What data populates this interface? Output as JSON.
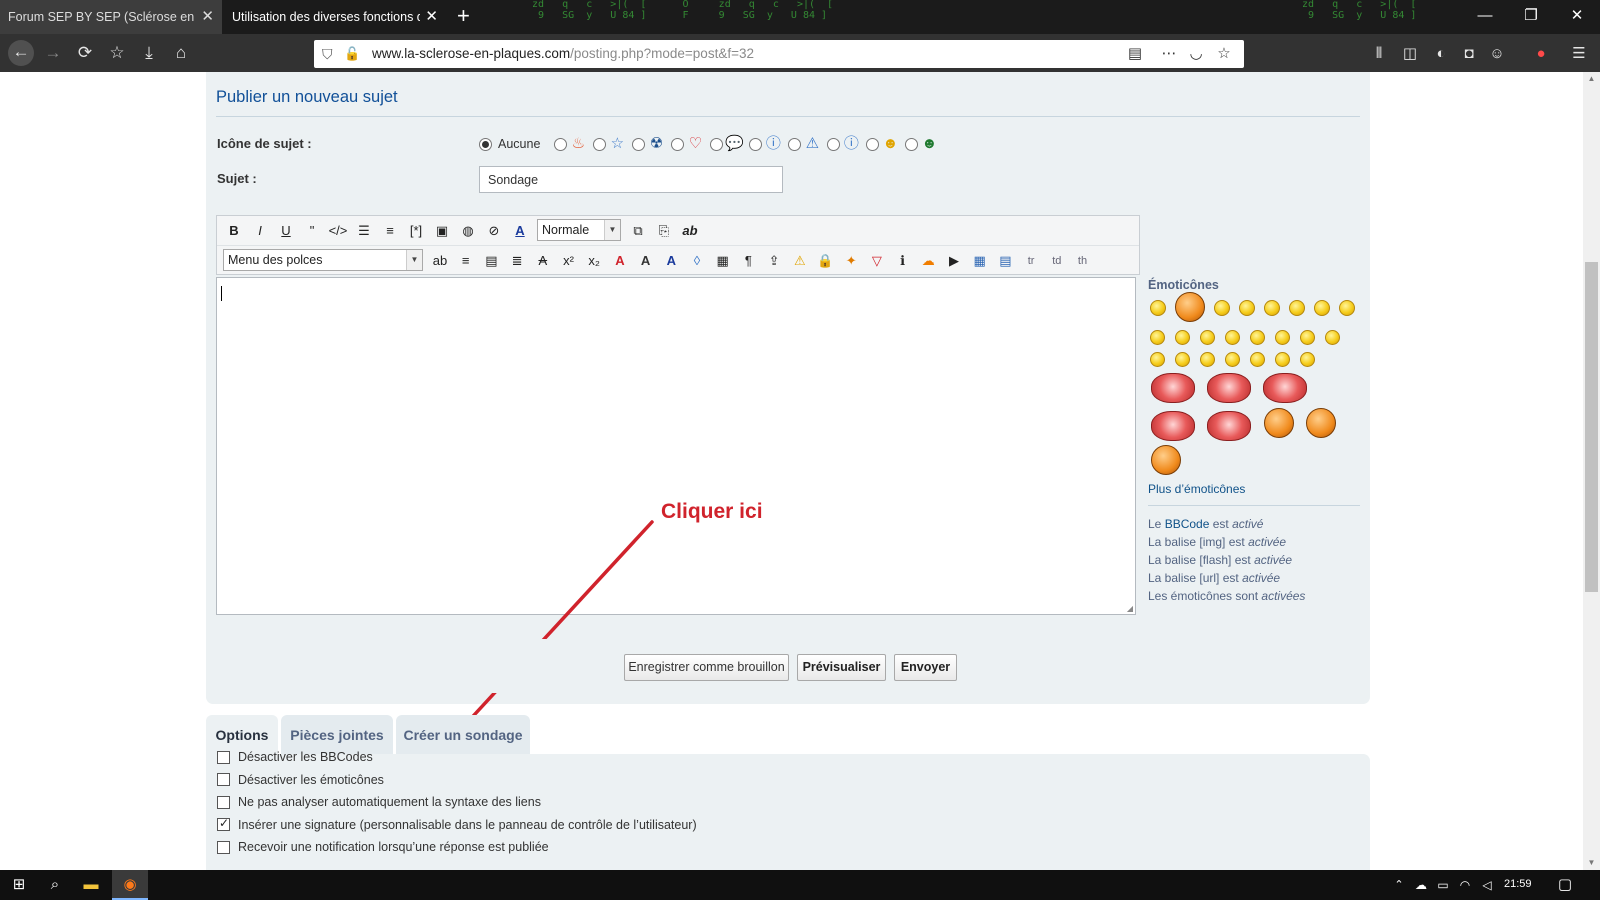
{
  "browser": {
    "tabs": [
      {
        "title": "Forum SEP BY SEP (Sclérose en plaques)"
      },
      {
        "title": "Utilisation des diverses fonctions du forum"
      }
    ],
    "url_domain": "www.la-sclerose-en-plaques.com",
    "url_path": "/posting.php?mode=post&f=32",
    "icons": [
      "back-icon",
      "forward-icon",
      "reload-icon",
      "bookmark-star-icon",
      "download-icon",
      "home-icon",
      "shield-icon",
      "insecure-lock-icon",
      "reader-view-icon",
      "more-icon",
      "pocket-icon",
      "star-icon",
      "library-icon",
      "sidebar-icon",
      "extension-icon",
      "account-icon",
      "firefox-menu-icon"
    ]
  },
  "post": {
    "title": "Publier un nouveau sujet",
    "topic_icon_label": "Icône de sujet :",
    "topic_icon_none": "Aucune",
    "topic_icons": [
      "fire-icon",
      "star-outline-icon",
      "radioactive-icon",
      "heart-outline-icon",
      "speech-bubble-icon",
      "question-icon",
      "warning-icon",
      "info-icon",
      "wink-smiley-icon",
      "grin-smiley-icon"
    ],
    "subject_label": "Sujet :",
    "subject_value": "Sondage"
  },
  "editor": {
    "row1_buttons": [
      {
        "name": "bold-button",
        "glyph": "B"
      },
      {
        "name": "italic-button",
        "glyph": "I"
      },
      {
        "name": "underline-button",
        "glyph": "U"
      },
      {
        "name": "quote-button",
        "glyph": "\""
      },
      {
        "name": "code-button",
        "glyph": "</>"
      },
      {
        "name": "list-button",
        "glyph": "☰"
      },
      {
        "name": "ordered-list-button",
        "glyph": "≡"
      },
      {
        "name": "list-item-button",
        "glyph": "[*]"
      },
      {
        "name": "image-button",
        "glyph": "▣"
      },
      {
        "name": "url-button",
        "glyph": "◍"
      },
      {
        "name": "flash-button",
        "glyph": "⊘"
      },
      {
        "name": "font-color-button",
        "glyph": "A"
      }
    ],
    "size_select": "Normale",
    "row1_extra": [
      {
        "name": "copy-button",
        "glyph": "⧉"
      },
      {
        "name": "paste-button",
        "glyph": "⎘"
      },
      {
        "name": "spellcheck-button",
        "glyph": "ab"
      }
    ],
    "font_select": "Menu des polces",
    "row2_buttons": [
      {
        "name": "highlight-button",
        "glyph": "ab"
      },
      {
        "name": "align-center-button",
        "glyph": "≡"
      },
      {
        "name": "align-justify-button",
        "glyph": "▤"
      },
      {
        "name": "align-right-button",
        "glyph": "≣"
      },
      {
        "name": "strike-button",
        "glyph": "A"
      },
      {
        "name": "superscript-button",
        "glyph": "x²"
      },
      {
        "name": "subscript-button",
        "glyph": "x₂"
      },
      {
        "name": "outline-text-button",
        "glyph": "A"
      },
      {
        "name": "shadow-text-button",
        "glyph": "A"
      },
      {
        "name": "glow-text-button",
        "glyph": "A"
      },
      {
        "name": "drop-button",
        "glyph": "◊"
      },
      {
        "name": "gradient-button",
        "glyph": "▦"
      },
      {
        "name": "paragraph-button",
        "glyph": "¶"
      },
      {
        "name": "upload-button",
        "glyph": "⇪"
      },
      {
        "name": "warning-button",
        "glyph": "⚠"
      },
      {
        "name": "lock-button",
        "glyph": "🔒"
      },
      {
        "name": "spoiler-button",
        "glyph": "✦"
      },
      {
        "name": "hide-button",
        "glyph": "▽"
      },
      {
        "name": "info-button",
        "glyph": "ℹ"
      },
      {
        "name": "soundcloud-button",
        "glyph": "☁"
      },
      {
        "name": "video-button",
        "glyph": "▶"
      },
      {
        "name": "table-button",
        "glyph": "▦"
      },
      {
        "name": "table2-button",
        "glyph": "▤"
      },
      {
        "name": "tr-button",
        "glyph": "tr"
      },
      {
        "name": "td-button",
        "glyph": "td"
      },
      {
        "name": "th-button",
        "glyph": "th"
      }
    ]
  },
  "sidebar": {
    "emoticons_title": "Émoticônes",
    "more_emoticons": "Plus d’émoticônes",
    "status": [
      {
        "a": "Le ",
        "link": "BBCode",
        "b": " est ",
        "em": "activé"
      },
      {
        "a": "La balise [img] est ",
        "link": "",
        "b": "",
        "em": "activée"
      },
      {
        "a": "La balise [flash] est ",
        "link": "",
        "b": "",
        "em": "activée"
      },
      {
        "a": "La balise [url] est ",
        "link": "",
        "b": "",
        "em": "activée"
      },
      {
        "a": "Les émoticônes sont ",
        "link": "",
        "b": "",
        "em": "activées"
      }
    ]
  },
  "actions": {
    "draft": "Enregistrer comme brouillon",
    "preview": "Prévisualiser",
    "submit": "Envoyer"
  },
  "option_tabs": [
    "Options",
    "Pièces jointes",
    "Créer un sondage"
  ],
  "options": [
    {
      "label": "Désactiver les BBCodes",
      "checked": false
    },
    {
      "label": "Désactiver les émoticônes",
      "checked": false
    },
    {
      "label": "Ne pas analyser automatiquement la syntaxe des liens",
      "checked": false
    },
    {
      "label": "Insérer une signature (personnalisable dans le panneau de contrôle de l’utilisateur)",
      "checked": true
    },
    {
      "label": "Recevoir une notification lorsqu’une réponse est publiée",
      "checked": false
    }
  ],
  "annotation": "Cliquer ici",
  "taskbar": {
    "time": "21:59",
    "icons": [
      "windows-start-icon",
      "search-icon",
      "file-explorer-icon",
      "firefox-icon",
      "chevron-up-icon",
      "onedrive-icon",
      "battery-icon",
      "wifi-icon",
      "volume-icon",
      "notification-icon"
    ]
  },
  "colors": {
    "link": "#105289",
    "title": "#115098",
    "panel": "#ecf1f3",
    "annotation": "#d0232c"
  }
}
